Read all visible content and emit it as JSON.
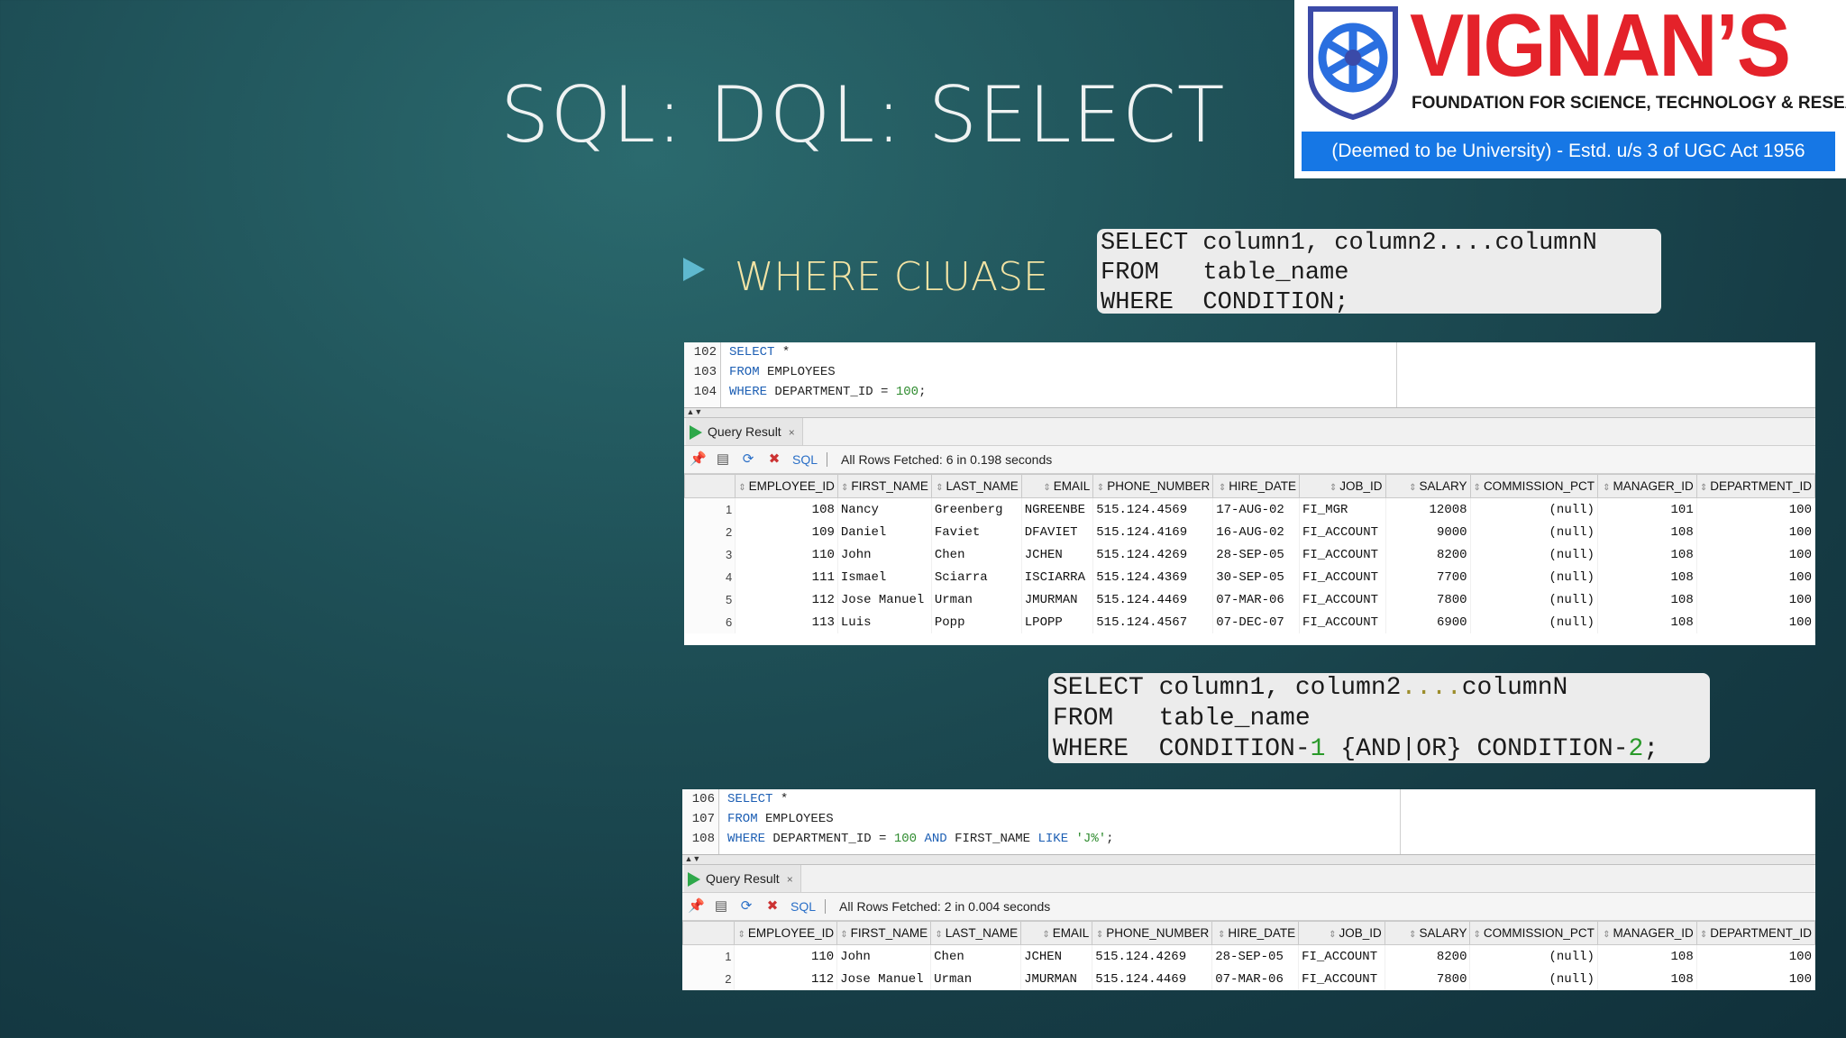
{
  "slide": {
    "title": "SQL: DQL: SELECT",
    "bullet": "WHERE CLUASE"
  },
  "logo": {
    "name": "VIGNAN’S",
    "subtitle": "FOUNDATION FOR SCIENCE, TECHNOLOGY & RESEARCH",
    "band": "(Deemed to be University) - Estd. u/s 3 of UGC Act 1956"
  },
  "syntax1": {
    "line1": "SELECT column1, column2....columnN",
    "line2": "FROM   table_name",
    "line3": "WHERE  CONDITION;"
  },
  "syntax2": {
    "kw1": "SELECT",
    "l1a": " column1, column2",
    "l1dots": "....",
    "l1b": "columnN",
    "kw2": "FROM",
    "l2": "   table_name",
    "kw3": "WHERE",
    "l3a": "  CONDITION-",
    "l3n1": "1",
    "l3b": " {AND|OR} CONDITION-",
    "l3n2": "2",
    "l3c": ";"
  },
  "colors": {
    "keyword": "#1d5fb4",
    "number": "#2e8b2e",
    "logo_red": "#e4222a",
    "logo_blue": "#1677e5",
    "bullet_text": "#f2e3a4"
  },
  "panel1": {
    "lines": [
      {
        "no": "102",
        "kw": "SELECT",
        "rest": " *"
      },
      {
        "no": "103",
        "kw": "FROM",
        "rest": " EMPLOYEES"
      },
      {
        "no": "104",
        "kw": "WHERE",
        "rest": " DEPARTMENT_ID = ",
        "num": "100",
        "end": ";"
      }
    ],
    "tab": "Query Result",
    "toolbar_sql": "SQL",
    "status": "All Rows Fetched: 6 in 0.198 seconds",
    "rows": [
      [
        "1",
        "108",
        "Nancy",
        "Greenberg",
        "NGREENBE",
        "515.124.4569",
        "17-AUG-02",
        "FI_MGR",
        "12008",
        "(null)",
        "101",
        "100"
      ],
      [
        "2",
        "109",
        "Daniel",
        "Faviet",
        "DFAVIET",
        "515.124.4169",
        "16-AUG-02",
        "FI_ACCOUNT",
        "9000",
        "(null)",
        "108",
        "100"
      ],
      [
        "3",
        "110",
        "John",
        "Chen",
        "JCHEN",
        "515.124.4269",
        "28-SEP-05",
        "FI_ACCOUNT",
        "8200",
        "(null)",
        "108",
        "100"
      ],
      [
        "4",
        "111",
        "Ismael",
        "Sciarra",
        "ISCIARRA",
        "515.124.4369",
        "30-SEP-05",
        "FI_ACCOUNT",
        "7700",
        "(null)",
        "108",
        "100"
      ],
      [
        "5",
        "112",
        "Jose Manuel",
        "Urman",
        "JMURMAN",
        "515.124.4469",
        "07-MAR-06",
        "FI_ACCOUNT",
        "7800",
        "(null)",
        "108",
        "100"
      ],
      [
        "6",
        "113",
        "Luis",
        "Popp",
        "LPOPP",
        "515.124.4567",
        "07-DEC-07",
        "FI_ACCOUNT",
        "6900",
        "(null)",
        "108",
        "100"
      ]
    ]
  },
  "panel2": {
    "lines": [
      {
        "no": "106",
        "kw": "SELECT",
        "rest": " *"
      },
      {
        "no": "107",
        "kw": "FROM",
        "rest": " EMPLOYEES"
      },
      {
        "no": "108",
        "kw": "WHERE",
        "rest": " DEPARTMENT_ID = ",
        "num": "100",
        "kw2": " AND",
        "rest2": " FIRST_NAME ",
        "kw3": "LIKE",
        "str": " 'J%'",
        "end": ";"
      }
    ],
    "tab": "Query Result",
    "toolbar_sql": "SQL",
    "status": "All Rows Fetched: 2 in 0.004 seconds",
    "rows": [
      [
        "1",
        "110",
        "John",
        "Chen",
        "JCHEN",
        "515.124.4269",
        "28-SEP-05",
        "FI_ACCOUNT",
        "8200",
        "(null)",
        "108",
        "100"
      ],
      [
        "2",
        "112",
        "Jose Manuel",
        "Urman",
        "JMURMAN",
        "515.124.4469",
        "07-MAR-06",
        "FI_ACCOUNT",
        "7800",
        "(null)",
        "108",
        "100"
      ]
    ]
  },
  "columns": [
    "EMPLOYEE_ID",
    "FIRST_NAME",
    "LAST_NAME",
    "EMAIL",
    "PHONE_NUMBER",
    "HIRE_DATE",
    "JOB_ID",
    "SALARY",
    "COMMISSION_PCT",
    "MANAGER_ID",
    "DEPARTMENT_ID"
  ]
}
